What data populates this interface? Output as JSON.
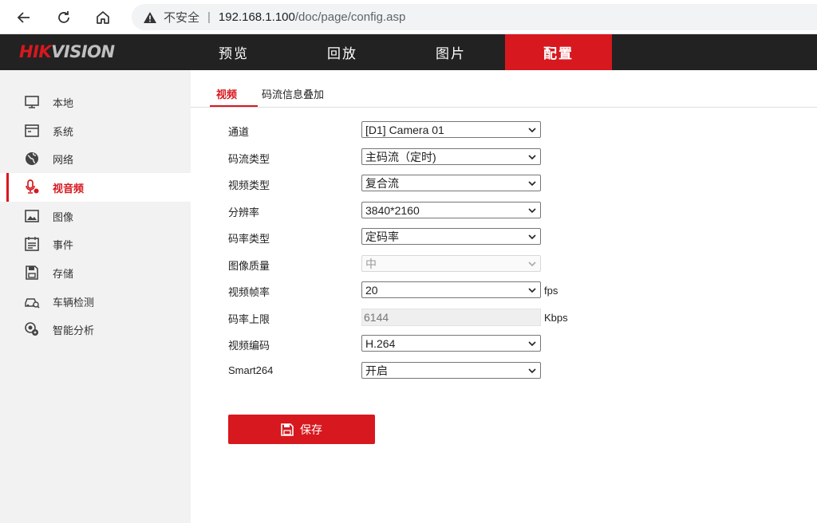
{
  "browser": {
    "insecure_label": "不安全",
    "separator": "|",
    "url_host": "192.168.1.100",
    "url_path": "/doc/page/config.asp"
  },
  "brand": {
    "logo_part1": "HIK",
    "logo_part2": "VISION"
  },
  "topnav": {
    "items": [
      {
        "label": "预览"
      },
      {
        "label": "回放"
      },
      {
        "label": "图片"
      },
      {
        "label": "配置"
      }
    ],
    "active": "配置"
  },
  "sidebar": {
    "items": [
      {
        "label": "本地",
        "icon": "monitor-icon"
      },
      {
        "label": "系统",
        "icon": "system-window-icon"
      },
      {
        "label": "网络",
        "icon": "globe-icon"
      },
      {
        "label": "视音频",
        "icon": "microphone-icon"
      },
      {
        "label": "图像",
        "icon": "image-icon"
      },
      {
        "label": "事件",
        "icon": "calendar-icon"
      },
      {
        "label": "存储",
        "icon": "floppy-icon"
      },
      {
        "label": "车辆检测",
        "icon": "car-detect-icon"
      },
      {
        "label": "智能分析",
        "icon": "smart-analysis-icon"
      }
    ],
    "active": "视音频"
  },
  "tabs": [
    {
      "label": "视频"
    },
    {
      "label": "码流信息叠加"
    }
  ],
  "form": {
    "channel": {
      "label": "通道",
      "value": "[D1] Camera 01"
    },
    "stream_type": {
      "label": "码流类型",
      "value": "主码流（定时)"
    },
    "video_type": {
      "label": "视频类型",
      "value": "复合流"
    },
    "resolution": {
      "label": "分辨率",
      "value": "3840*2160"
    },
    "bitrate_type": {
      "label": "码率类型",
      "value": "定码率"
    },
    "image_quality": {
      "label": "图像质量",
      "value": "中"
    },
    "frame_rate": {
      "label": "视频帧率",
      "value": "20",
      "unit": "fps"
    },
    "max_bitrate": {
      "label": "码率上限",
      "value": "6144",
      "unit": "Kbps"
    },
    "encoding": {
      "label": "视频编码",
      "value": "H.264"
    },
    "smart264": {
      "label": "Smart264",
      "value": "开启"
    }
  },
  "save": {
    "label": "保存"
  },
  "colors": {
    "accent": "#d7181f",
    "topnav_bg": "#222222",
    "sidebar_bg": "#f2f2f2"
  }
}
